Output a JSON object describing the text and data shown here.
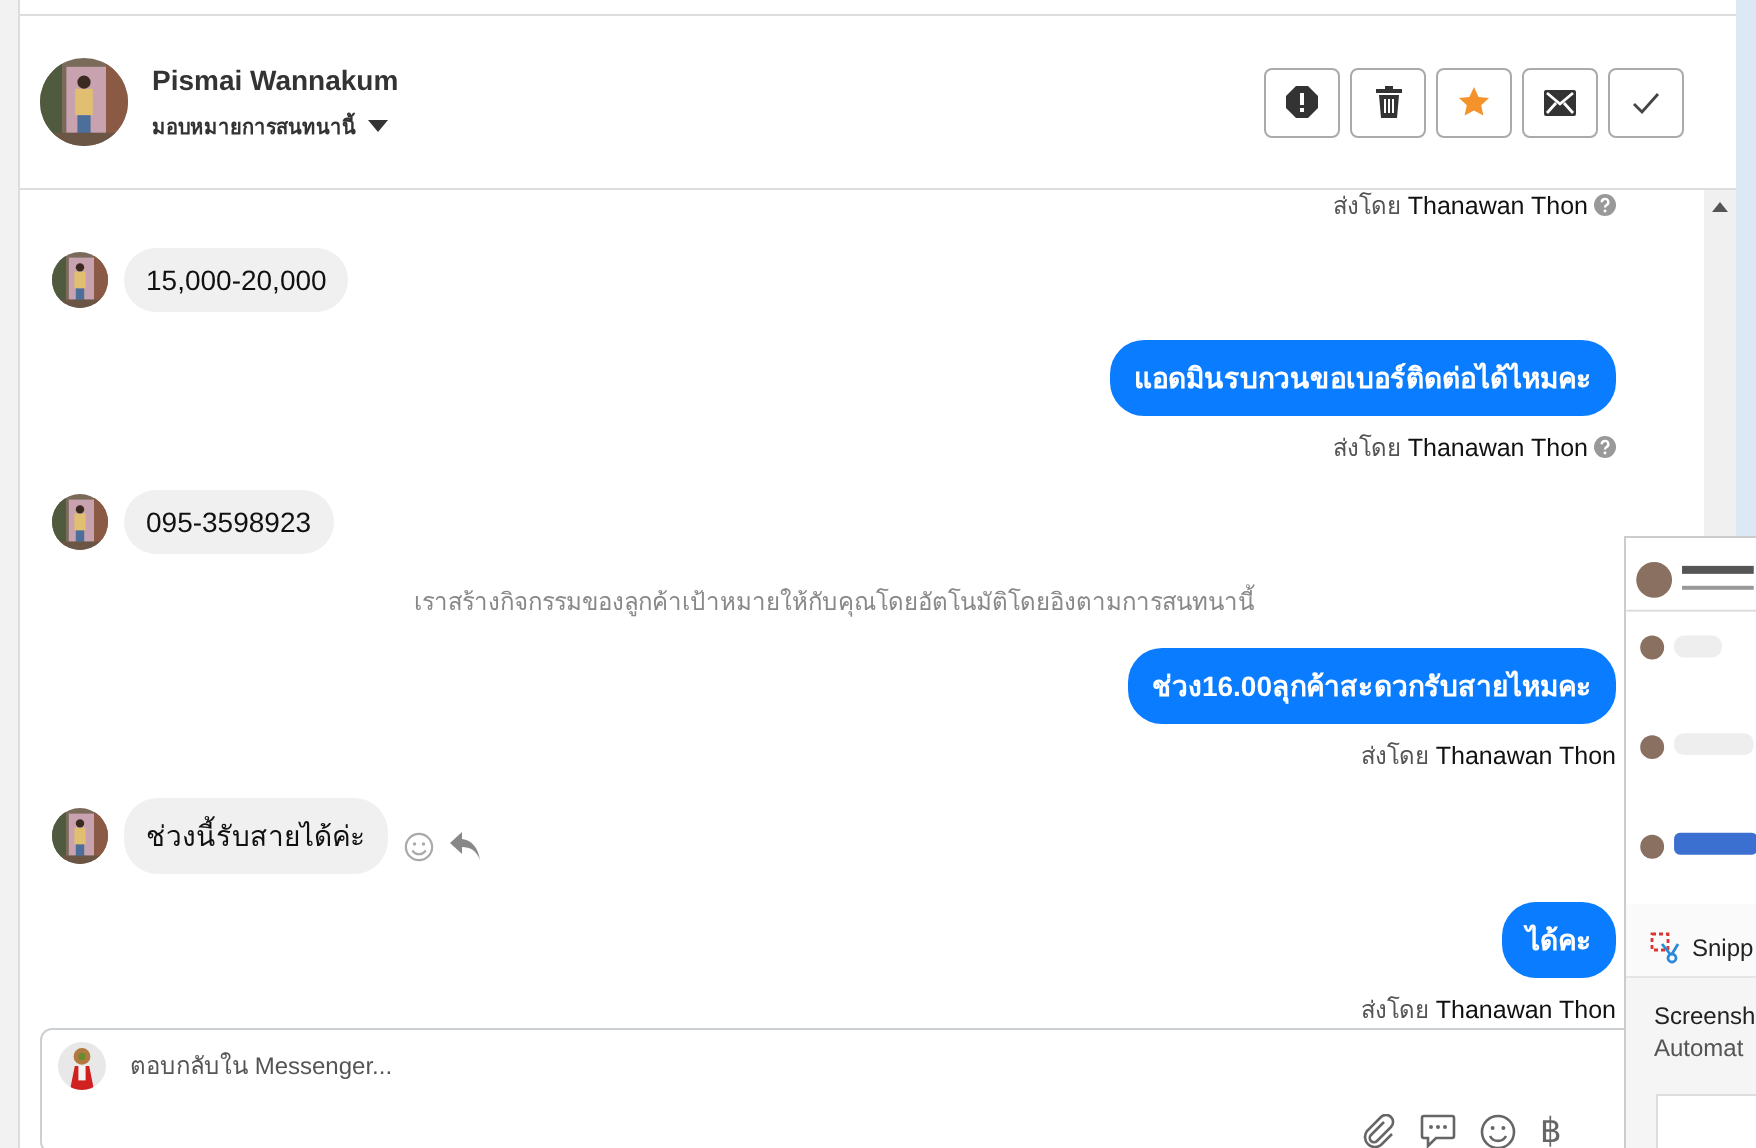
{
  "header": {
    "name": "Pismai Wannakum",
    "assign_label": "มอบหมายการสนทนานี้",
    "actions": [
      {
        "kind": "alert"
      },
      {
        "kind": "delete"
      },
      {
        "kind": "star"
      },
      {
        "kind": "mail"
      },
      {
        "kind": "done"
      }
    ]
  },
  "messages": [
    {
      "kind": "sent_by",
      "prefix": "ส่งโดย",
      "sender": "Thanawan Thon",
      "help_icon": true
    },
    {
      "kind": "incoming",
      "text": "15,000-20,000",
      "actions": false
    },
    {
      "kind": "outgoing",
      "text": "แอดมินรบกวนขอเบอร์ติดต่อได้ไหมคะ"
    },
    {
      "kind": "sent_by",
      "prefix": "ส่งโดย",
      "sender": "Thanawan Thon",
      "help_icon": true
    },
    {
      "kind": "incoming",
      "text": "095-3598923",
      "actions": false
    },
    {
      "kind": "notice",
      "text": "เราสร้างกิจกรรมของลูกค้าเป้าหมายให้กับคุณโดยอัตโนมัติโดยอิงตามการสนทนานี้"
    },
    {
      "kind": "outgoing",
      "text": "ช่วง16.00ลุกค้าสะดวกรับสายไหมคะ"
    },
    {
      "kind": "sent_by",
      "prefix": "ส่งโดย",
      "sender": "Thanawan Thon",
      "help_icon": false
    },
    {
      "kind": "incoming",
      "text": "ช่วงนี้รับสายได้ค่ะ",
      "actions": true
    },
    {
      "kind": "outgoing",
      "text": "ได้คะ"
    },
    {
      "kind": "sent_by",
      "prefix": "ส่งโดย",
      "sender": "Thanawan Thon",
      "help_icon": false
    }
  ],
  "composer": {
    "placeholder": "ตอบกลับใน Messenger...",
    "tools": [
      {
        "kind": "attach"
      },
      {
        "kind": "chat"
      },
      {
        "kind": "emoji"
      },
      {
        "kind": "text",
        "label": "฿"
      }
    ]
  },
  "notification": {
    "app": "Snipp",
    "title": "Screensh",
    "body": "Automat"
  }
}
